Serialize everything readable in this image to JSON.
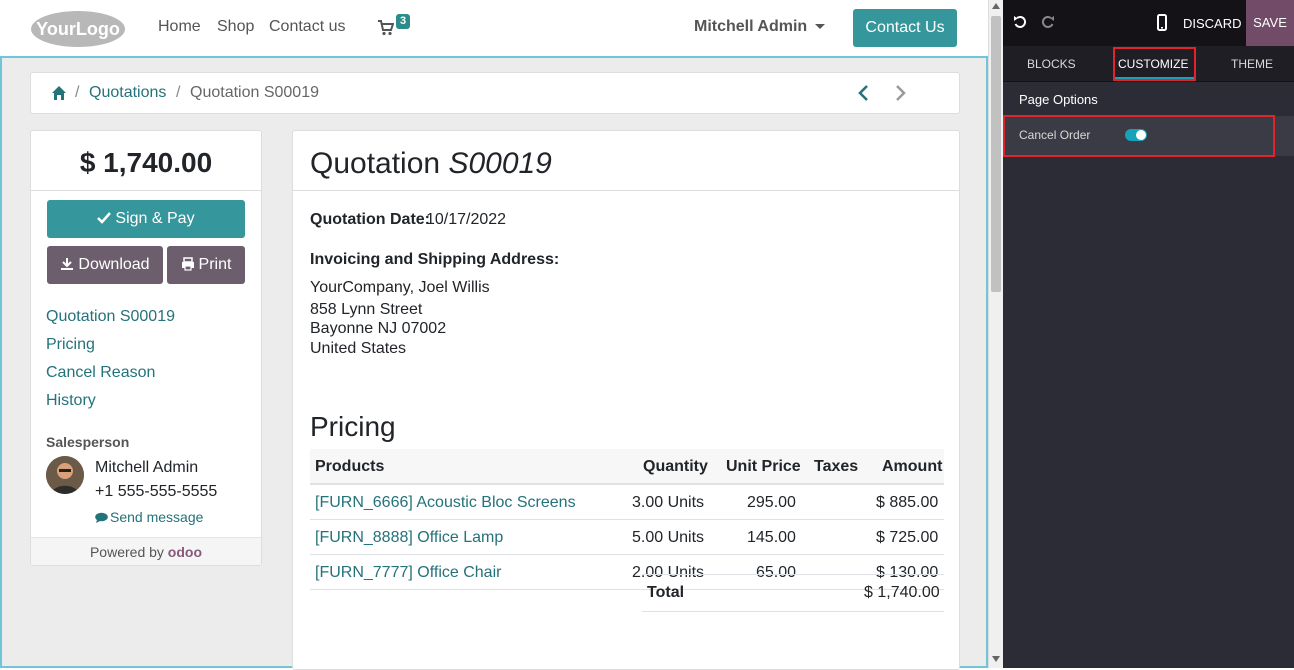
{
  "navbar": {
    "logo_text": "YourLogo",
    "links": [
      "Home",
      "Shop",
      "Contact us"
    ],
    "cart_count": "3",
    "user_name": "Mitchell Admin",
    "contact_button": "Contact Us"
  },
  "breadcrumb": {
    "items": [
      "Quotations",
      "Quotation S00019"
    ],
    "separator": "/"
  },
  "sidebar": {
    "amount": "$ 1,740.00",
    "sign_pay": "Sign & Pay",
    "download": "Download",
    "print": "Print",
    "toc": [
      "Quotation S00019",
      "Pricing",
      "Cancel Reason",
      "History"
    ],
    "salesperson_label": "Salesperson",
    "salesperson_name": "Mitchell Admin",
    "salesperson_phone": "+1 555-555-5555",
    "send_message": "Send message",
    "powered_by": "Powered by",
    "powered_brand": "odoo"
  },
  "quotation": {
    "title_prefix": "Quotation",
    "number": "S00019",
    "date_label": "Quotation Date:",
    "date_value": "10/17/2022",
    "address_label": "Invoicing and Shipping Address:",
    "address_lines": [
      "YourCompany, Joel Willis",
      "858 Lynn Street",
      "Bayonne NJ 07002",
      "United States"
    ],
    "pricing_title": "Pricing",
    "columns": [
      "Products",
      "Quantity",
      "Unit Price",
      "Taxes",
      "Amount"
    ],
    "rows": [
      {
        "product": "[FURN_6666] Acoustic Bloc Screens",
        "quantity": "3.00 Units",
        "unit_price": "295.00",
        "taxes": "",
        "amount": "$ 885.00"
      },
      {
        "product": "[FURN_8888] Office Lamp",
        "quantity": "5.00 Units",
        "unit_price": "145.00",
        "taxes": "",
        "amount": "$ 725.00"
      },
      {
        "product": "[FURN_7777] Office Chair",
        "quantity": "2.00 Units",
        "unit_price": "65.00",
        "taxes": "",
        "amount": "$ 130.00"
      }
    ],
    "total_label": "Total",
    "total_value": "$ 1,740.00"
  },
  "editor": {
    "discard": "DISCARD",
    "save": "SAVE",
    "tabs": [
      "BLOCKS",
      "CUSTOMIZE",
      "THEME"
    ],
    "active_tab": "CUSTOMIZE",
    "page_options_label": "Page Options",
    "option_label": "Cancel Order",
    "option_enabled": true
  },
  "colors": {
    "primary_teal": "#35979c",
    "link_teal": "#24727a",
    "secondary_mauve": "#6d5e6d",
    "editor_bg": "#2c2c36",
    "save_purple": "#714b67",
    "highlight_red": "#e0242b",
    "toggle_on": "#17a2b8"
  }
}
